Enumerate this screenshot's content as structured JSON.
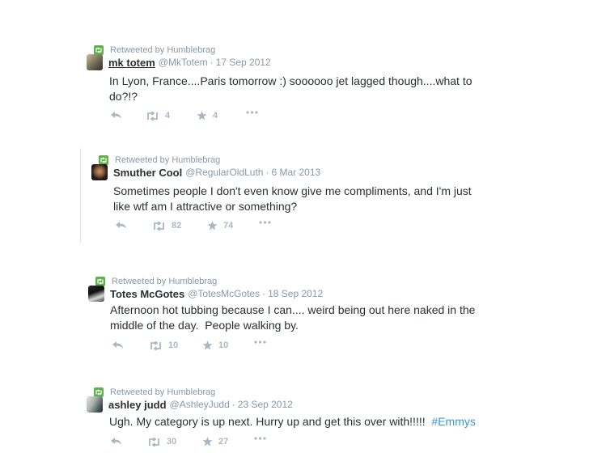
{
  "colors": {
    "retweet_green": "#5eb04a",
    "action_gray": "#aab8c2",
    "meta_gray": "#8899a6",
    "hashtag_blue": "#3b94d9"
  },
  "icons": {
    "retweet_badge": "retweet-icon",
    "reply": "reply-icon",
    "retweet": "retweet-icon",
    "favorite": "star-icon",
    "more": "more-icon"
  },
  "tweets": [
    {
      "retweeted_by": "Retweeted by Humblebrag",
      "name": "mk totem",
      "handle": "@MkTotem",
      "date": "17 Sep 2012",
      "line1": "In Lyon, France....Paris tomorrow :) soooooo jet lagged though....what to",
      "line2": "do?!?",
      "retweets": "4",
      "favorites": "4"
    },
    {
      "retweeted_by": "Retweeted by Humblebrag",
      "name": "Smuther Cool",
      "handle": "@RegularOldLuth",
      "date": "6 Mar 2013",
      "line1": "Sometimes people I don't even know give me compliments, and I'm just",
      "line2": "like wtf am I attractive or something?",
      "retweets": "82",
      "favorites": "74"
    },
    {
      "retweeted_by": "Retweeted by Humblebrag",
      "name": "Totes McGotes",
      "handle": "@TotesMcGotes",
      "date": "18 Sep 2012",
      "line1": "Afternoon hot tubbing because I can.... weird being out here naked in the",
      "line2": "middle of the day.  People walking by.",
      "retweets": "10",
      "favorites": "10"
    },
    {
      "retweeted_by": "Retweeted by Humblebrag",
      "name": "ashley judd",
      "handle": "@AshleyJudd",
      "date": "23 Sep 2012",
      "line1": "Ugh. My category is up next. Hurry up and get this over with!!!!!",
      "hashtag": "#Emmys",
      "retweets": "30",
      "favorites": "27"
    }
  ]
}
